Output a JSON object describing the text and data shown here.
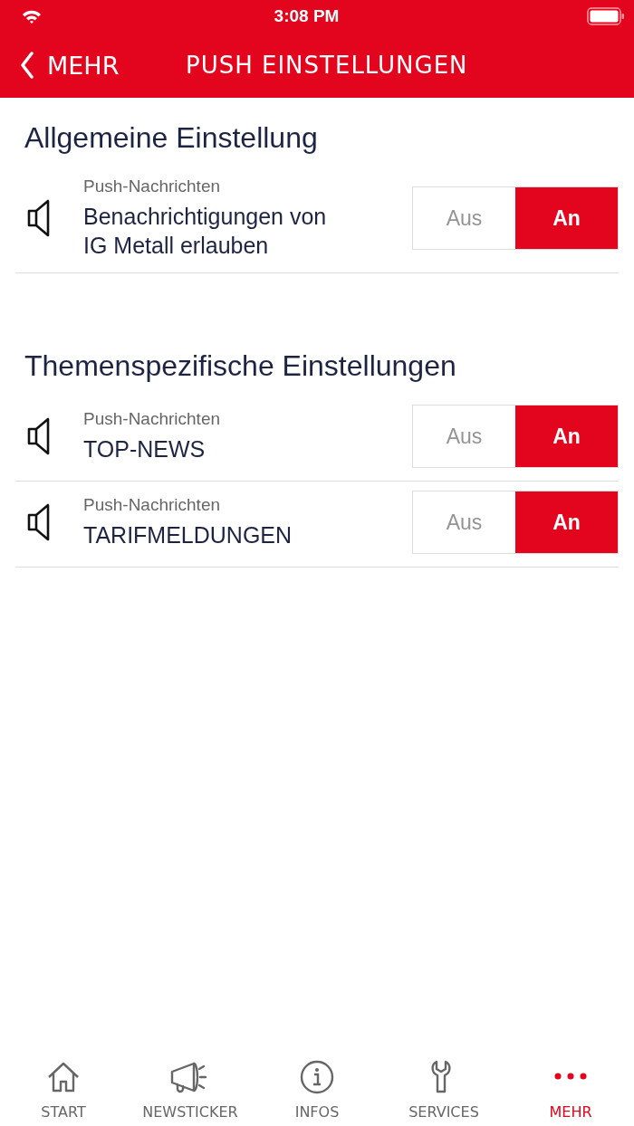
{
  "status_bar": {
    "time": "3:08 PM"
  },
  "nav": {
    "back_label": "MEHR",
    "title": "PUSH EINSTELLUNGEN"
  },
  "sections": [
    {
      "heading": "Allgemeine Einstellung",
      "rows": [
        {
          "caption": "Push-Nachrichten",
          "title": "Benachrichtigungen von IG Metall erlauben",
          "off_label": "Aus",
          "on_label": "An",
          "on": true
        }
      ]
    },
    {
      "heading": "Themenspezifische Einstellungen",
      "rows": [
        {
          "caption": "Push-Nachrichten",
          "title": "TOP-NEWS",
          "off_label": "Aus",
          "on_label": "An",
          "on": true
        },
        {
          "caption": "Push-Nachrichten",
          "title": "TARIFMELDUNGEN",
          "off_label": "Aus",
          "on_label": "An",
          "on": true
        }
      ]
    }
  ],
  "tab_bar": [
    {
      "kind": "home",
      "label": "START",
      "selected": false
    },
    {
      "kind": "megaphone",
      "label": "NEWSTICKER",
      "selected": false
    },
    {
      "kind": "info",
      "label": "INFOS",
      "selected": false
    },
    {
      "kind": "wrench",
      "label": "SERVICES",
      "selected": false
    },
    {
      "kind": "more",
      "label": "MEHR",
      "selected": true
    }
  ]
}
